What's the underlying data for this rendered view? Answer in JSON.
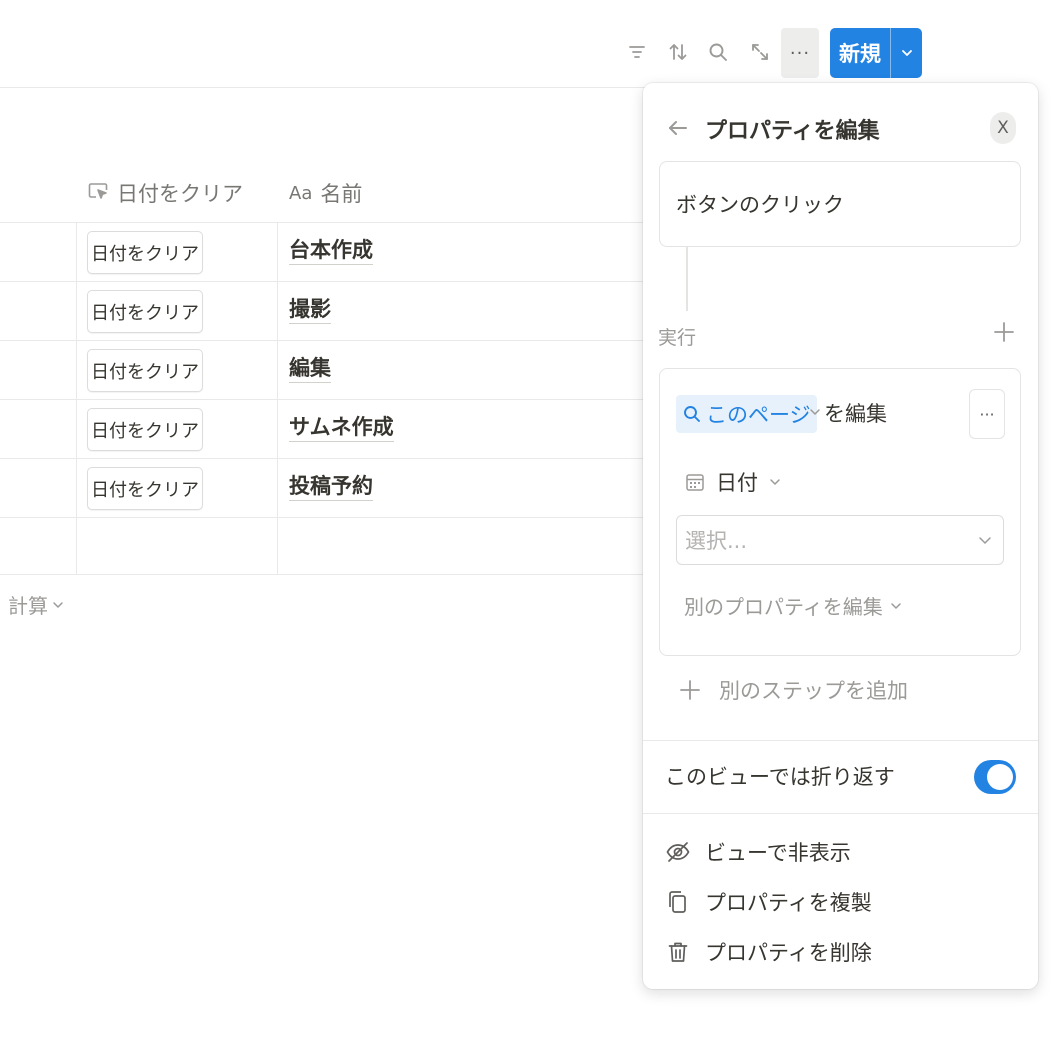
{
  "toolbar": {
    "icons": [
      "filter-icon",
      "sort-icon",
      "search-icon",
      "expand-icon"
    ],
    "more_label": "···",
    "new_label": "新規"
  },
  "table": {
    "columns": [
      {
        "icon": "button-cursor-icon",
        "label": "日付をクリア"
      },
      {
        "icon": "title-aa-icon",
        "label": "名前",
        "icon_text": "Aa"
      }
    ],
    "rows": [
      {
        "button": "日付をクリア",
        "name": "台本作成"
      },
      {
        "button": "日付をクリア",
        "name": "撮影"
      },
      {
        "button": "日付をクリア",
        "name": "編集"
      },
      {
        "button": "日付をクリア",
        "name": "サムネ作成"
      },
      {
        "button": "日付をクリア",
        "name": "投稿予約"
      }
    ],
    "calc_label": "計算"
  },
  "panel": {
    "title": "プロパティを編集",
    "close_label": "X",
    "trigger": "ボタンのクリック",
    "run_label": "実行",
    "action": {
      "target": "このページ",
      "verb": "を編集",
      "more_label": "···",
      "property": "日付",
      "select_placeholder": "選択...",
      "other_property": "別のプロパティを編集"
    },
    "add_step": "別のステップを追加",
    "wrap_label": "このビューでは折り返す",
    "wrap_enabled": true,
    "menu": [
      {
        "icon": "eye-off-icon",
        "label": "ビューで非表示"
      },
      {
        "icon": "duplicate-icon",
        "label": "プロパティを複製"
      },
      {
        "icon": "trash-icon",
        "label": "プロパティを削除"
      }
    ]
  },
  "colors": {
    "accent": "#2383e2",
    "text": "#37352f",
    "muted": "#9b9a97",
    "border": "#e9e9e7"
  }
}
